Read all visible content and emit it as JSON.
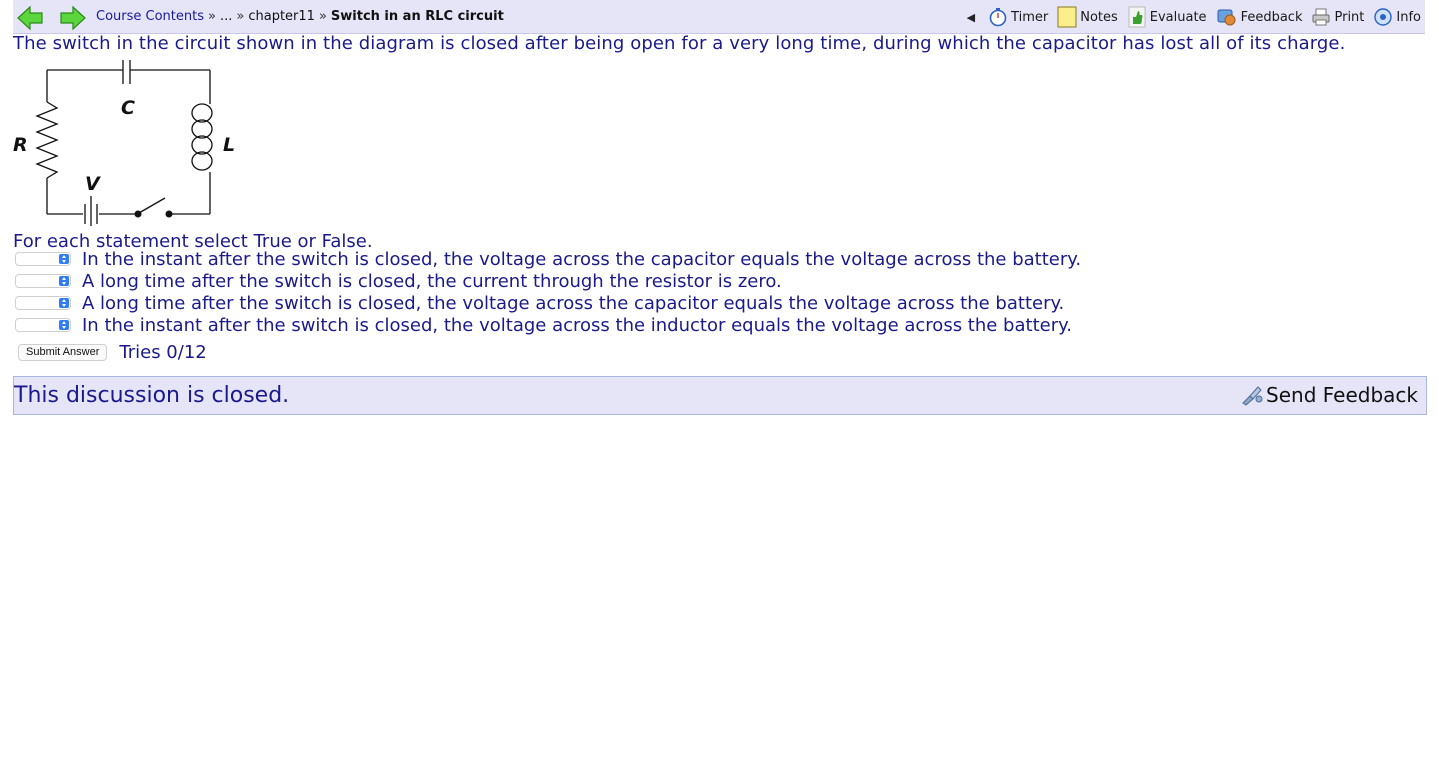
{
  "breadcrumb": {
    "course_contents": "Course Contents",
    "sep1": "»",
    "ellipsis": "...",
    "sep2": "»",
    "chapter": "chapter11",
    "sep3": "»",
    "current": "Switch in an RLC circuit"
  },
  "tools": {
    "collapse": "◀",
    "timer": "Timer",
    "notes": "Notes",
    "evaluate": "Evaluate",
    "feedback": "Feedback",
    "print": "Print",
    "info": "Info"
  },
  "problem": {
    "intro": "The switch in the circuit shown in the diagram is closed after being open for a very long time, during which the capacitor has lost all of its charge.",
    "diagram_labels": {
      "c": "C",
      "r": "R",
      "l": "L",
      "v": "V"
    },
    "instructions": "For each statement select True or False.",
    "statements": [
      {
        "text": "In the instant after the switch is closed, the voltage across the capacitor equals the voltage across the battery.",
        "selected": ""
      },
      {
        "text": "A long time after the switch is closed, the current through the resistor is zero.",
        "selected": ""
      },
      {
        "text": "A long time after the switch is closed, the voltage across the capacitor equals the voltage across the battery.",
        "selected": ""
      },
      {
        "text": "In the instant after the switch is closed, the voltage across the inductor equals the voltage across the battery.",
        "selected": ""
      }
    ],
    "submit_label": "Submit Answer",
    "tries": "Tries 0/12"
  },
  "discussion": {
    "closed_text": "This discussion is closed.",
    "send_feedback": "Send Feedback"
  },
  "colors": {
    "bar_background": "#e6e4f7",
    "text_blue": "#1a1a8c",
    "select_accent": "#2f7cf6",
    "nav_arrow_green": "#5bd63c"
  }
}
